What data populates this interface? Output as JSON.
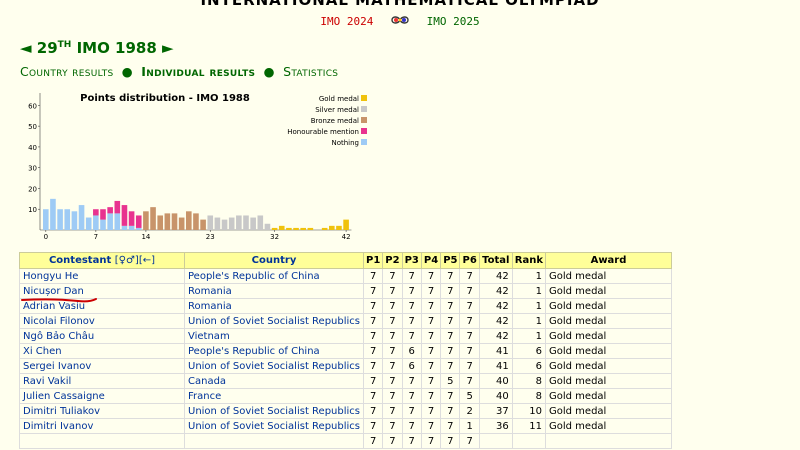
{
  "site_title": "INTERNATIONAL MATHEMATICAL OLYMPIAD",
  "nav": {
    "prev": "IMO 2024",
    "next": "IMO 2025",
    "logo_icon": "imo-logo-icon"
  },
  "heading": {
    "left_arrow": "◄",
    "number": "29",
    "suffix": "TH",
    "title": "IMO 1988",
    "right_arrow": "►"
  },
  "sections": {
    "country": "Country results",
    "individual": "Individual results",
    "statistics": "Statistics",
    "separator": "●"
  },
  "chart_data": {
    "type": "bar",
    "title": "Points distribution - IMO 1988",
    "x_ticks": [
      "0",
      "7",
      "14",
      "23",
      "32",
      "42"
    ],
    "y_ticks": [
      "10",
      "20",
      "30",
      "40",
      "50",
      "60"
    ],
    "ylim": [
      0,
      65
    ],
    "legend_position": "top-right",
    "legend": [
      {
        "name": "Gold medal",
        "color": "#f0c20c"
      },
      {
        "name": "Silver medal",
        "color": "#c8c8c8"
      },
      {
        "name": "Bronze medal",
        "color": "#c8946a"
      },
      {
        "name": "Honourable mention",
        "color": "#e8338f"
      },
      {
        "name": "Nothing",
        "color": "#9ecbf5"
      }
    ],
    "bars": [
      {
        "score": 0,
        "nothing": 10
      },
      {
        "score": 1,
        "nothing": 15
      },
      {
        "score": 2,
        "nothing": 10
      },
      {
        "score": 3,
        "nothing": 10
      },
      {
        "score": 4,
        "nothing": 9
      },
      {
        "score": 5,
        "nothing": 12
      },
      {
        "score": 6,
        "nothing": 6
      },
      {
        "score": 7,
        "nothing": 7,
        "honourable": 3
      },
      {
        "score": 8,
        "nothing": 5,
        "honourable": 5
      },
      {
        "score": 9,
        "nothing": 8,
        "honourable": 3
      },
      {
        "score": 10,
        "nothing": 8,
        "honourable": 6
      },
      {
        "score": 11,
        "nothing": 2,
        "honourable": 10
      },
      {
        "score": 12,
        "nothing": 2,
        "honourable": 7
      },
      {
        "score": 13,
        "nothing": 1,
        "honourable": 6
      },
      {
        "score": 14,
        "bronze": 9
      },
      {
        "score": 15,
        "bronze": 11
      },
      {
        "score": 16,
        "bronze": 7
      },
      {
        "score": 17,
        "bronze": 8
      },
      {
        "score": 18,
        "bronze": 8
      },
      {
        "score": 19,
        "bronze": 6
      },
      {
        "score": 20,
        "bronze": 9
      },
      {
        "score": 21,
        "bronze": 8
      },
      {
        "score": 22,
        "bronze": 5
      },
      {
        "score": 23,
        "silver": 7
      },
      {
        "score": 24,
        "silver": 6
      },
      {
        "score": 25,
        "silver": 5
      },
      {
        "score": 26,
        "silver": 6
      },
      {
        "score": 27,
        "silver": 7
      },
      {
        "score": 28,
        "silver": 7
      },
      {
        "score": 29,
        "silver": 6
      },
      {
        "score": 30,
        "silver": 7
      },
      {
        "score": 31,
        "silver": 3
      },
      {
        "score": 32,
        "gold": 1
      },
      {
        "score": 33,
        "gold": 2
      },
      {
        "score": 34,
        "gold": 1
      },
      {
        "score": 35,
        "gold": 1
      },
      {
        "score": 36,
        "gold": 1
      },
      {
        "score": 37,
        "gold": 1
      },
      {
        "score": 38,
        "gold": 0
      },
      {
        "score": 39,
        "gold": 1
      },
      {
        "score": 40,
        "gold": 2
      },
      {
        "score": 41,
        "gold": 2
      },
      {
        "score": 42,
        "gold": 5
      }
    ]
  },
  "table": {
    "headers": {
      "contestant": "Contestant",
      "gender": "[♀♂]",
      "back": "[←]",
      "country": "Country",
      "p1": "P1",
      "p2": "P2",
      "p3": "P3",
      "p4": "P4",
      "p5": "P5",
      "p6": "P6",
      "total": "Total",
      "rank": "Rank",
      "award": "Award"
    },
    "rows": [
      {
        "name": "Hongyu He",
        "country": "People's Republic of China",
        "p": [
          "7",
          "7",
          "7",
          "7",
          "7",
          "7"
        ],
        "total": "42",
        "rank": "1",
        "award": "Gold medal"
      },
      {
        "name": "Nicușor Dan",
        "country": "Romania",
        "p": [
          "7",
          "7",
          "7",
          "7",
          "7",
          "7"
        ],
        "total": "42",
        "rank": "1",
        "award": "Gold medal"
      },
      {
        "name": "Adrian Vasiu",
        "country": "Romania",
        "p": [
          "7",
          "7",
          "7",
          "7",
          "7",
          "7"
        ],
        "total": "42",
        "rank": "1",
        "award": "Gold medal"
      },
      {
        "name": "Nicolai Filonov",
        "country": "Union of Soviet Socialist Republics",
        "p": [
          "7",
          "7",
          "7",
          "7",
          "7",
          "7"
        ],
        "total": "42",
        "rank": "1",
        "award": "Gold medal"
      },
      {
        "name": "Ngô Bảo Châu",
        "country": "Vietnam",
        "p": [
          "7",
          "7",
          "7",
          "7",
          "7",
          "7"
        ],
        "total": "42",
        "rank": "1",
        "award": "Gold medal"
      },
      {
        "name": "Xi Chen",
        "country": "People's Republic of China",
        "p": [
          "7",
          "7",
          "6",
          "7",
          "7",
          "7"
        ],
        "total": "41",
        "rank": "6",
        "award": "Gold medal"
      },
      {
        "name": "Sergei Ivanov",
        "country": "Union of Soviet Socialist Republics",
        "p": [
          "7",
          "7",
          "6",
          "7",
          "7",
          "7"
        ],
        "total": "41",
        "rank": "6",
        "award": "Gold medal"
      },
      {
        "name": "Ravi Vakil",
        "country": "Canada",
        "p": [
          "7",
          "7",
          "7",
          "7",
          "5",
          "7"
        ],
        "total": "40",
        "rank": "8",
        "award": "Gold medal"
      },
      {
        "name": "Julien Cassaigne",
        "country": "France",
        "p": [
          "7",
          "7",
          "7",
          "7",
          "7",
          "5"
        ],
        "total": "40",
        "rank": "8",
        "award": "Gold medal"
      },
      {
        "name": "Dimitri Tuliakov",
        "country": "Union of Soviet Socialist Republics",
        "p": [
          "7",
          "7",
          "7",
          "7",
          "7",
          "2"
        ],
        "total": "37",
        "rank": "10",
        "award": "Gold medal"
      },
      {
        "name": "Dimitri Ivanov",
        "country": "Union of Soviet Socialist Republics",
        "p": [
          "7",
          "7",
          "7",
          "7",
          "7",
          "1"
        ],
        "total": "36",
        "rank": "11",
        "award": "Gold medal"
      },
      {
        "name": "",
        "country": "",
        "p": [
          "7",
          "7",
          "7",
          "7",
          "7",
          "7"
        ],
        "total": "",
        "rank": "",
        "award": ""
      }
    ]
  }
}
